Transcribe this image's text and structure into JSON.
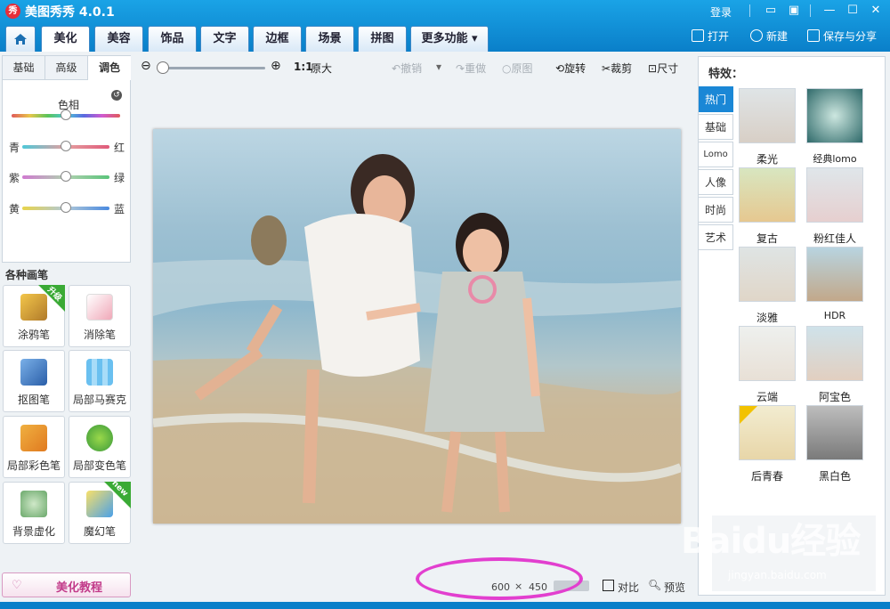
{
  "app": {
    "title": "美图秀秀 4.0.1",
    "logo_text": "秀",
    "login": "登录"
  },
  "tabs": [
    {
      "label": ""
    },
    {
      "label": "美化"
    },
    {
      "label": "美容"
    },
    {
      "label": "饰品"
    },
    {
      "label": "文字"
    },
    {
      "label": "边框"
    },
    {
      "label": "场景"
    },
    {
      "label": "拼图"
    },
    {
      "label": "更多功能 ▾"
    }
  ],
  "top_actions": {
    "open": "打开",
    "new": "新建",
    "save_share": "保存与分享"
  },
  "left": {
    "subtabs": [
      "基础",
      "高级",
      "调色"
    ],
    "hue_label": "色相",
    "sliders": [
      {
        "left": "青",
        "right": "红"
      },
      {
        "left": "紫",
        "right": "绿"
      },
      {
        "left": "黄",
        "right": "蓝"
      }
    ],
    "brush_title": "各种画笔",
    "brushes": [
      {
        "label": "涂鸦笔",
        "badge": "升级"
      },
      {
        "label": "消除笔",
        "badge": ""
      },
      {
        "label": "抠图笔",
        "badge": ""
      },
      {
        "label": "局部马赛克",
        "badge": ""
      },
      {
        "label": "局部彩色笔",
        "badge": ""
      },
      {
        "label": "局部变色笔",
        "badge": ""
      },
      {
        "label": "背景虚化",
        "badge": ""
      },
      {
        "label": "魔幻笔",
        "badge": "new"
      }
    ],
    "tutorial": "美化教程"
  },
  "toolbar": {
    "ratio": "1:1",
    "original_size": "原大",
    "undo": "撤销",
    "redo": "重做",
    "original": "原图",
    "rotate": "旋转",
    "crop": "裁剪",
    "size": "尺寸"
  },
  "status": {
    "width": "600",
    "x": "×",
    "height": "450",
    "compare": "对比",
    "preview": "预览"
  },
  "effects": {
    "title": "特效：",
    "tabs": [
      "热门",
      "基础",
      "Lomo",
      "人像",
      "时尚",
      "艺术"
    ],
    "items": [
      {
        "label": "柔光"
      },
      {
        "label": "经典lomo"
      },
      {
        "label": "复古"
      },
      {
        "label": "粉红佳人"
      },
      {
        "label": "淡雅"
      },
      {
        "label": "HDR"
      },
      {
        "label": "云端"
      },
      {
        "label": "阿宝色"
      },
      {
        "label": "后青春"
      },
      {
        "label": "黑白色"
      }
    ]
  },
  "watermark": {
    "brand": "Baidu经验",
    "url": "jingyan.baidu.com"
  },
  "colors": {
    "accent": "#1a87d6",
    "title_bar": "#0a7fc9",
    "highlight_circle": "#e23fcf"
  }
}
